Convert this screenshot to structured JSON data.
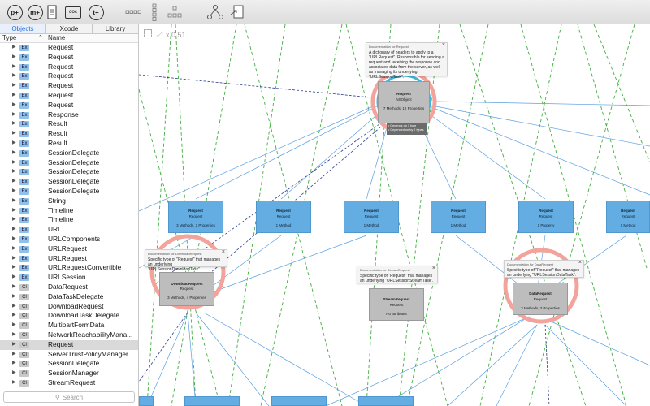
{
  "toolbar": {
    "buttons": [
      {
        "name": "add-property-button",
        "label": "p+"
      },
      {
        "name": "add-method-button",
        "label": "m+"
      },
      {
        "name": "documentation-button",
        "label": "doc"
      },
      {
        "name": "add-type-button",
        "label": "t+"
      }
    ],
    "icons": [
      "layout-horizontal-icon",
      "layout-vertical-icon",
      "layout-tree-icon",
      "hierarchy-icon",
      "export-icon"
    ]
  },
  "sidebar": {
    "tabs": [
      "Objects",
      "Xcode",
      "Library"
    ],
    "columns": {
      "type": "Type",
      "name": "Name"
    },
    "search_placeholder": "Search",
    "items": [
      {
        "kind": "Ex",
        "name": "Request"
      },
      {
        "kind": "Ex",
        "name": "Request"
      },
      {
        "kind": "Ex",
        "name": "Request"
      },
      {
        "kind": "Ex",
        "name": "Request"
      },
      {
        "kind": "Ex",
        "name": "Request"
      },
      {
        "kind": "Ex",
        "name": "Request"
      },
      {
        "kind": "Ex",
        "name": "Request"
      },
      {
        "kind": "Ex",
        "name": "Response"
      },
      {
        "kind": "Ex",
        "name": "Result"
      },
      {
        "kind": "Ex",
        "name": "Result"
      },
      {
        "kind": "Ex",
        "name": "Result"
      },
      {
        "kind": "Ex",
        "name": "SessionDelegate"
      },
      {
        "kind": "Ex",
        "name": "SessionDelegate"
      },
      {
        "kind": "Ex",
        "name": "SessionDelegate"
      },
      {
        "kind": "Ex",
        "name": "SessionDelegate"
      },
      {
        "kind": "Ex",
        "name": "SessionDelegate"
      },
      {
        "kind": "Ex",
        "name": "String"
      },
      {
        "kind": "Ex",
        "name": "Timeline"
      },
      {
        "kind": "Ex",
        "name": "Timeline"
      },
      {
        "kind": "Ex",
        "name": "URL"
      },
      {
        "kind": "Ex",
        "name": "URLComponents"
      },
      {
        "kind": "Ex",
        "name": "URLRequest"
      },
      {
        "kind": "Ex",
        "name": "URLRequest"
      },
      {
        "kind": "Ex",
        "name": "URLRequestConvertible"
      },
      {
        "kind": "Ex",
        "name": "URLSession"
      },
      {
        "kind": "Cl",
        "name": "DataRequest"
      },
      {
        "kind": "Cl",
        "name": "DataTaskDelegate"
      },
      {
        "kind": "Cl",
        "name": "DownloadRequest"
      },
      {
        "kind": "Cl",
        "name": "DownloadTaskDelegate"
      },
      {
        "kind": "Cl",
        "name": "MultipartFormData"
      },
      {
        "kind": "Cl",
        "name": "NetworkReachabilityMana..."
      },
      {
        "kind": "Cl",
        "name": "Request",
        "selected": true
      },
      {
        "kind": "Cl",
        "name": "ServerTrustPolicyManager"
      },
      {
        "kind": "Cl",
        "name": "SessionDelegate"
      },
      {
        "kind": "Cl",
        "name": "SessionManager"
      },
      {
        "kind": "Cl",
        "name": "StreamRequest"
      }
    ]
  },
  "canvas": {
    "zoom_label": "x 0.51",
    "main_node": {
      "title": "Request",
      "subtitle": "NSObject",
      "meta": "7 Methods, 12 Properties",
      "info": [
        "• Depends on 1 type",
        "• Depended on by 2 types"
      ]
    },
    "main_doc": {
      "title": "Documentation for Request",
      "text": "A dictionary of headers to apply to a \"URLRequest\". Responsible for sending a request and receiving the response and associated data from the server, as well as managing its underlying \"URLSessionTask\"."
    },
    "row_nodes": [
      {
        "title": "Request",
        "subtitle": "Request",
        "meta": "3 Methods, 2 Properties"
      },
      {
        "title": "Request",
        "subtitle": "Request",
        "meta": "1 Method"
      },
      {
        "title": "Request",
        "subtitle": "Request",
        "meta": "1 Method"
      },
      {
        "title": "Request",
        "subtitle": "Request",
        "meta": "1 Method"
      },
      {
        "title": "Request",
        "subtitle": "Request",
        "meta": "1 Property"
      },
      {
        "title": "Request",
        "subtitle": "Request",
        "meta": "1 Method"
      }
    ],
    "download_node": {
      "title": "DownloadRequest",
      "subtitle": "Request",
      "meta": "3 Methods, 4 Properties"
    },
    "download_doc": {
      "title": "Documentation for DownloadRequest",
      "text": "Specific type of \"Request\" that manages an underlying \"URLSessionDownloadTask\"."
    },
    "stream_node": {
      "title": "StreamRequest",
      "subtitle": "Request",
      "meta": "No attributes"
    },
    "stream_doc": {
      "title": "Documentation for StreamRequest",
      "text": "Specific type of \"Request\" that manages an underlying \"URLSessionStreamTask\"."
    },
    "data_node": {
      "title": "DataRequest",
      "subtitle": "Request",
      "meta": "3 Methods, 3 Properties"
    },
    "data_doc": {
      "title": "Documentation for DataRequest",
      "text": "Specific type of \"Request\" that manages an underlying \"URLSessionDataTask\"."
    }
  },
  "colors": {
    "node_blue": "#63ade3",
    "halo": "#f2a49c",
    "halo_main": "#3eb6dd",
    "green_dash": "#3fae3f",
    "blue_line": "#5a9fe0",
    "navy_dash": "#2c3e8c"
  }
}
